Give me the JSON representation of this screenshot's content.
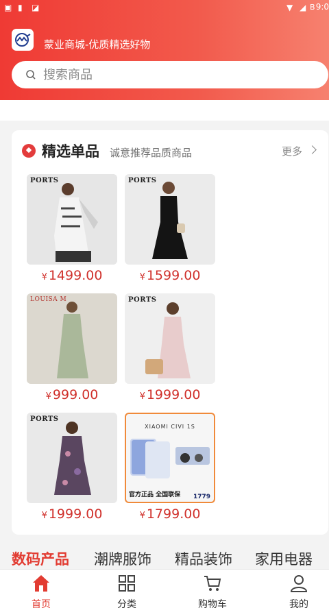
{
  "status_bar": {
    "time": "9:0",
    "battery": "B"
  },
  "header": {
    "title": "蒙业商城-优质精选好物"
  },
  "search": {
    "placeholder": "搜索商品"
  },
  "section": {
    "title": "精选单品",
    "subtitle": "诚意推荐品质商品",
    "more": "更多"
  },
  "products": [
    {
      "brand": "PORTS",
      "currency": "¥",
      "price": "1499.00"
    },
    {
      "brand": "PORTS",
      "currency": "¥",
      "price": "1599.00"
    },
    {
      "brand": "LOUISA M",
      "currency": "¥",
      "price": "999.00"
    },
    {
      "brand": "PORTS",
      "currency": "¥",
      "price": "1999.00"
    },
    {
      "brand": "PORTS",
      "currency": "¥",
      "price": "1999.00"
    },
    {
      "brand": "XIAOMI CIVI 1S",
      "promo": "官方正品 全国联保",
      "promo_price": "1779",
      "currency": "¥",
      "price": "1799.00"
    }
  ],
  "categories": [
    "数码产品",
    "潮牌服饰",
    "精品装饰",
    "家用电器"
  ],
  "tabs": [
    {
      "label": "首页",
      "icon": "home-icon"
    },
    {
      "label": "分类",
      "icon": "grid-icon"
    },
    {
      "label": "购物车",
      "icon": "cart-icon"
    },
    {
      "label": "我的",
      "icon": "user-icon"
    }
  ],
  "colors": {
    "brand_red": "#e23c32",
    "price_red": "#d0312c",
    "header_gradient": [
      "#ef3a34",
      "#f6816f"
    ]
  }
}
